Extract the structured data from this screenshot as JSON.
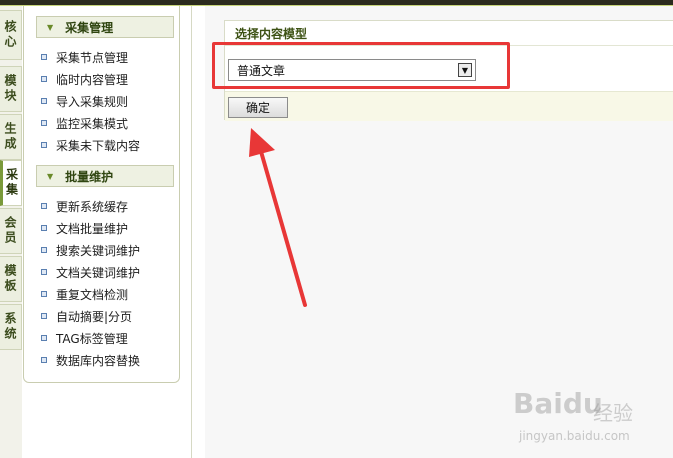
{
  "tabs": [
    {
      "label": "核心"
    },
    {
      "label": "模块"
    },
    {
      "label": "生成"
    },
    {
      "label": "采集",
      "active": true
    },
    {
      "label": "会员"
    },
    {
      "label": "模板"
    },
    {
      "label": "系统"
    }
  ],
  "menu": {
    "sections": [
      {
        "title": "采集管理",
        "items": [
          "采集节点管理",
          "临时内容管理",
          "导入采集规则",
          "监控采集模式",
          "采集未下载内容"
        ]
      },
      {
        "title": "批量维护",
        "items": [
          "更新系统缓存",
          "文档批量维护",
          "搜索关键词维护",
          "文档关键词维护",
          "重复文档检测",
          "自动摘要|分页",
          "TAG标签管理",
          "数据库内容替换"
        ]
      }
    ]
  },
  "main": {
    "title": "选择内容模型",
    "select_value": "普通文章",
    "confirm_label": "确定"
  },
  "watermark": {
    "logo": "Baidu",
    "text": "经验",
    "url": "jingyan.baidu.com"
  },
  "colors": {
    "annotation": "#e83737",
    "accent": "#7a9a3a"
  }
}
